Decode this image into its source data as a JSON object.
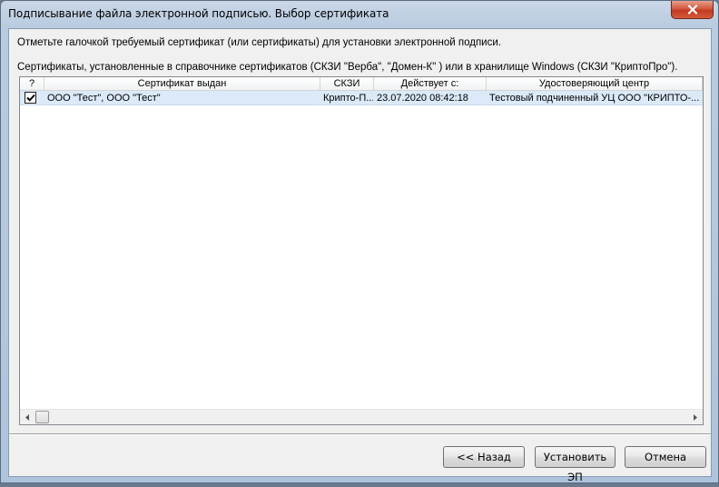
{
  "window": {
    "title": "Подписывание файла электронной подписью. Выбор сертификата"
  },
  "instructions": {
    "line1": "Отметьте галочкой требуемый сертификат (или сертификаты) для установки электронной подписи.",
    "line2": "Сертификаты, установленные в справочнике сертификатов (СКЗИ \"Верба\", \"Домен-К\" ) или в хранилище Windows (СКЗИ \"КриптоПро\")."
  },
  "table": {
    "headers": [
      "?",
      "Сертификат выдан",
      "СКЗИ",
      "Действует с:",
      "Удостоверяющий центр"
    ],
    "rows": [
      {
        "checked": true,
        "issued_to": "ООО \"Тест\", ООО \"Тест\"",
        "skzi": "Крипто-П...",
        "valid_from": "23.07.2020 08:42:18",
        "ca": "Тестовый подчиненный УЦ ООО \"КРИПТО-..."
      }
    ]
  },
  "buttons": {
    "back": "<< Назад",
    "install": "Установить ЭП",
    "cancel": "Отмена"
  },
  "colors": {
    "selected_row": "#dbe9f8",
    "close_button": "#c23a22"
  }
}
